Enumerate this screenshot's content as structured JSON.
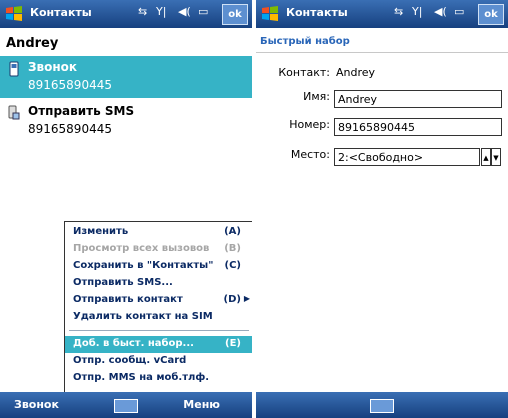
{
  "colors": {
    "titlebar": "#1f4f94",
    "selection": "#36b3c6",
    "link": "#2a66b8"
  },
  "left": {
    "title": "Контакты",
    "ok": "ok",
    "contact_name": "Andrey",
    "items": [
      {
        "label": "Звонок",
        "number": "89165890445",
        "icon": "phone-icon"
      },
      {
        "label": "Отправить SMS",
        "number": "89165890445",
        "icon": "sms-icon"
      }
    ],
    "menu": [
      {
        "label": "Изменить",
        "key": "(A)"
      },
      {
        "label": "Просмотр всех вызовов",
        "key": "(B)"
      },
      {
        "label": "Сохранить в \"Контакты\"",
        "key": "(C)"
      },
      {
        "label": "Отправить SMS...",
        "key": ""
      },
      {
        "label": "Отправить контакт",
        "key": "(D)"
      },
      {
        "label": "Удалить контакт на SIM",
        "key": ""
      },
      {
        "label": "Доб. в быст. набор...",
        "key": "(E)"
      },
      {
        "label": "Отпр. сообщ. vCard",
        "key": ""
      },
      {
        "label": "Отпр. MMS на моб.тлф.",
        "key": ""
      }
    ],
    "softkeys": {
      "left": "Звонок",
      "right": "Меню"
    }
  },
  "right": {
    "title": "Контакты",
    "ok": "ok",
    "subheader": "Быстрый набор",
    "contact_label": "Контакт:",
    "contact_value": "Andrey",
    "name_label": "Имя:",
    "name_value": "Andrey",
    "number_label": "Номер:",
    "number_value": "89165890445",
    "place_label": "Место:",
    "place_value": "2:<Свободно>"
  }
}
